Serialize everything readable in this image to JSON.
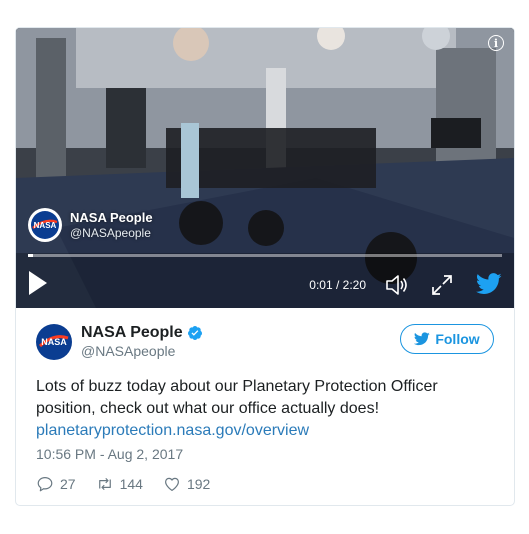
{
  "video": {
    "overlay_name": "NASA People",
    "overlay_handle": "@NASApeople",
    "time": "0:01 / 2:20",
    "progress_fraction": 0.01
  },
  "author": {
    "name": "NASA People",
    "handle": "@NASApeople",
    "verified": true,
    "avatar_label": "NASA"
  },
  "follow_label": "Follow",
  "tweet": {
    "text": "Lots of buzz today about our Planetary Protection Officer position, check out what our office actually does!",
    "link": "planetaryprotection.nasa.gov/overview",
    "timestamp": "10:56 PM - Aug 2, 2017"
  },
  "actions": {
    "replies": "27",
    "retweets": "144",
    "likes": "192"
  },
  "colors": {
    "accent": "#1b95e0",
    "link": "#2b7bb9",
    "muted": "#697882",
    "border": "#e1e8ed"
  },
  "icons": [
    "info-icon",
    "play-icon",
    "volume-icon",
    "fullscreen-icon",
    "twitter-bird-icon",
    "verified-icon",
    "reply-icon",
    "retweet-icon",
    "like-icon"
  ]
}
